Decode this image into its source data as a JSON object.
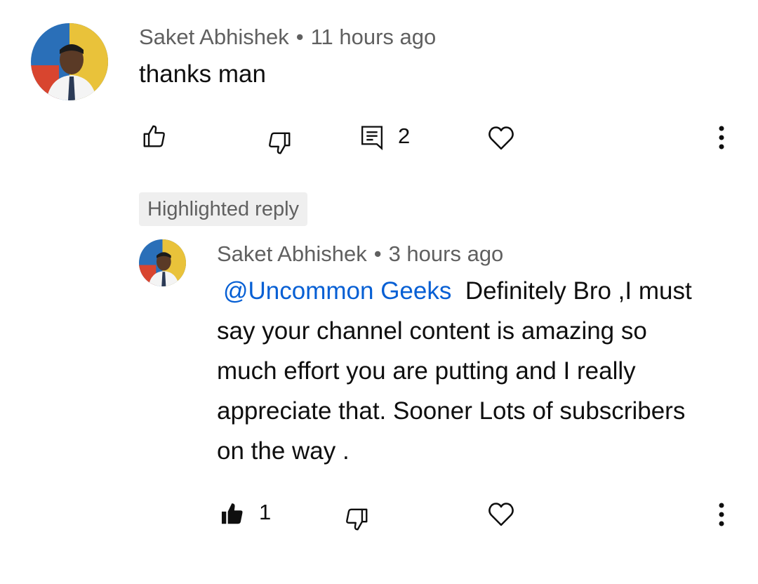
{
  "comment": {
    "author": "Saket Abhishek",
    "separator": "•",
    "time": "11 hours ago",
    "text": "thanks man",
    "reply_count": "2",
    "icons": {
      "like": "thumbs-up-outline-icon",
      "dislike": "thumbs-down-outline-icon",
      "reply": "comment-reply-icon",
      "heart": "heart-outline-icon",
      "more": "more-vertical-icon"
    }
  },
  "highlight_badge": "Highlighted reply",
  "reply": {
    "author": "Saket Abhishek",
    "separator": "•",
    "time": "3 hours ago",
    "mention": "@Uncommon Geeks",
    "text": "Definitely Bro ,I must say your channel content is amazing so much effort you are putting and I really appreciate that. Sooner Lots of subscribers on the way .",
    "like_count": "1",
    "icons": {
      "like": "thumbs-up-filled-icon",
      "dislike": "thumbs-down-outline-icon",
      "heart": "heart-outline-icon",
      "more": "more-vertical-icon"
    }
  },
  "colors": {
    "mention": "#065fd4",
    "meta": "#606060",
    "badge_bg": "#efefef"
  }
}
